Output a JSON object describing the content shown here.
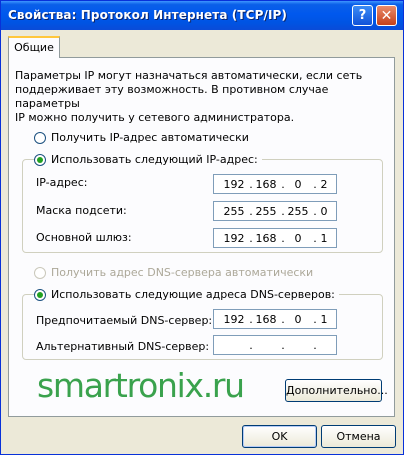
{
  "window": {
    "title": "Свойства: Протокол Интернета (TCP/IP)",
    "help_glyph": "?",
    "close_glyph": "✕"
  },
  "tabs": [
    {
      "label": "Общие",
      "selected": true
    }
  ],
  "intro_lines": [
    "Параметры IP могут назначаться автоматически, если сеть",
    "поддерживает эту возможность. В противном случае параметры",
    "IP можно получить у сетевого администратора."
  ],
  "ip_options": {
    "auto_label": "Получить IP-адрес автоматически",
    "auto_selected": false,
    "manual_label": "Использовать следующий IP-адрес:",
    "manual_selected": true
  },
  "ip_fields": [
    {
      "label": "IP-адрес:",
      "octets": [
        "192",
        "168",
        "0",
        "2"
      ]
    },
    {
      "label": "Маска подсети:",
      "octets": [
        "255",
        "255",
        "255",
        "0"
      ]
    },
    {
      "label": "Основной шлюз:",
      "octets": [
        "192",
        "168",
        "0",
        "1"
      ]
    }
  ],
  "dns_options": {
    "auto_label": "Получить адрес DNS-сервера автоматически",
    "auto_selected": false,
    "auto_disabled": true,
    "manual_label": "Использовать следующие адреса DNS-серверов:",
    "manual_selected": true
  },
  "dns_fields": [
    {
      "label": "Предпочитаемый DNS-сервер:",
      "octets": [
        "192",
        "168",
        "0",
        "1"
      ]
    },
    {
      "label": "Альтернативный DNS-сервер:",
      "octets": [
        "",
        "",
        "",
        ""
      ]
    }
  ],
  "watermark": "smartronix.ru",
  "buttons": {
    "advanced": "Дополнительно...",
    "ok": "OK",
    "cancel": "Отмена"
  },
  "colors": {
    "titlebar": "#0054e3",
    "selection": "#21a121",
    "watermark": "#3aa24d",
    "tab_highlight": "#ffc73c"
  }
}
